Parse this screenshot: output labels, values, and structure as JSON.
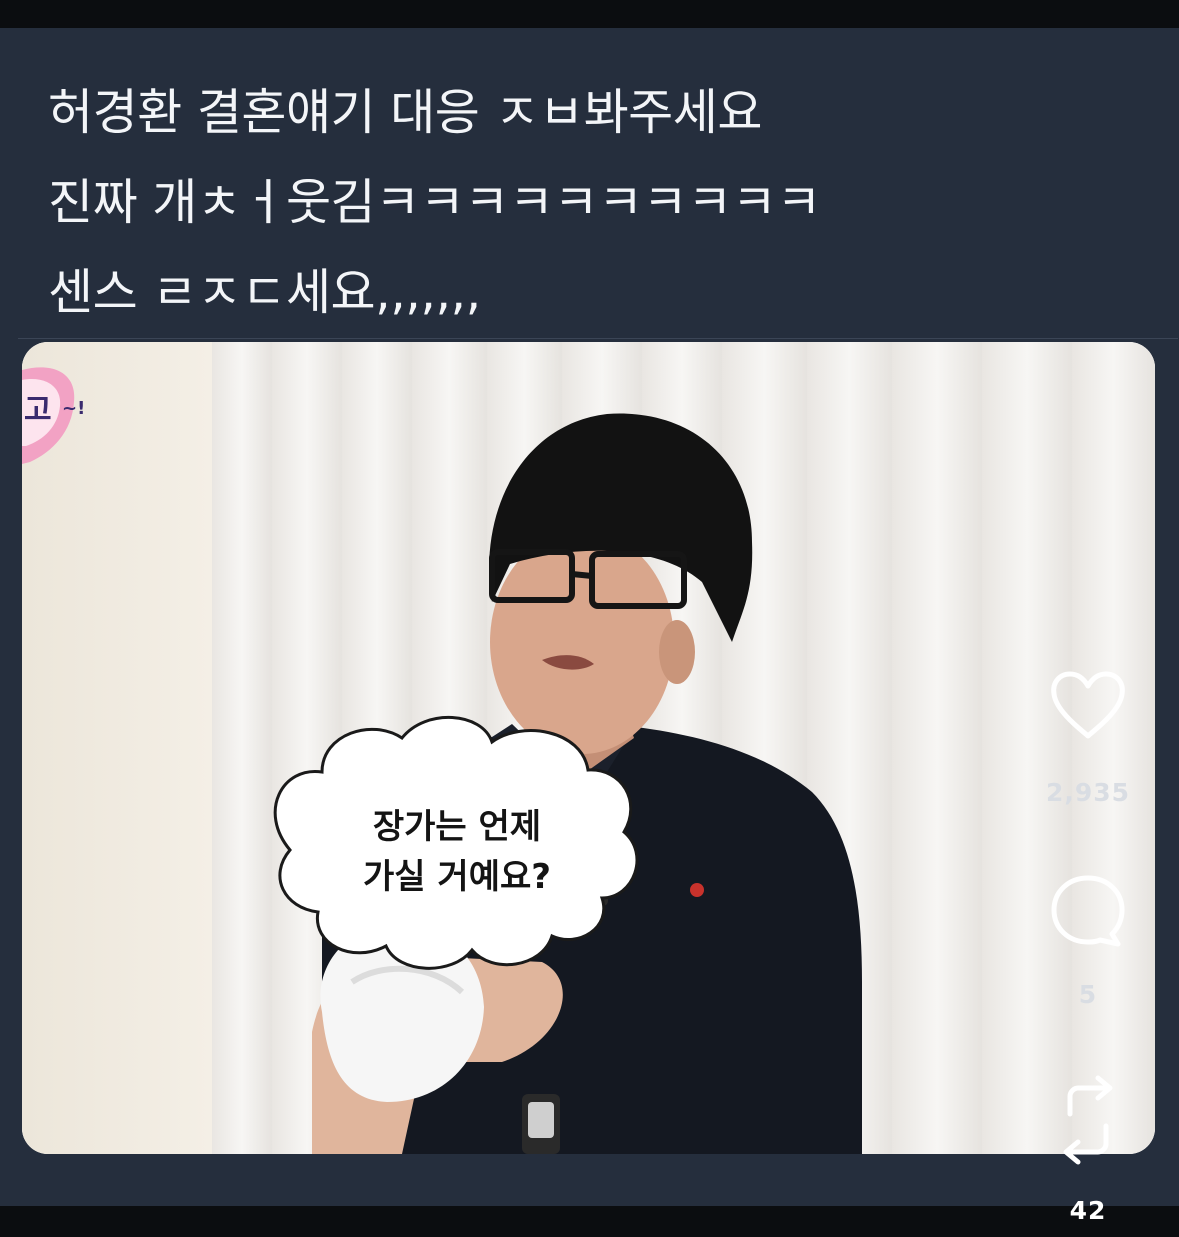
{
  "post": {
    "caption_lines": [
      "허경환 결혼얘기 대응 ㅈㅂ봐주세요",
      "진짜 개ㅊㅓ웃김ㅋㅋㅋㅋㅋㅋㅋㅋㅋㅋ",
      "센스 ㄹㅈㄷ세요,,,,,,,"
    ]
  },
  "video": {
    "speech_bubble_lines": [
      "장가는 언제",
      "가실 거예요?"
    ],
    "corner_logo_text": "고~!"
  },
  "actions": {
    "like": {
      "icon": "heart-icon",
      "count": "2,935"
    },
    "comment": {
      "icon": "comment-bubble-icon",
      "count": "5"
    },
    "repost": {
      "icon": "repost-icon",
      "count": "42"
    }
  },
  "colors": {
    "background": "#252e3d",
    "text": "#f3f5f8",
    "icon": "#ffffff"
  }
}
